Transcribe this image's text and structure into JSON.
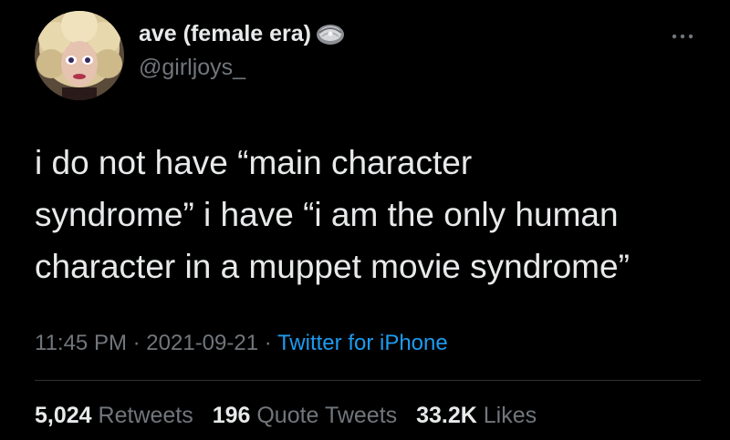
{
  "author": {
    "display_name": "ave (female era)",
    "handle": "@girljoys_",
    "name_emoji_icon": "oyster-icon",
    "avatar_icon": "avatar"
  },
  "tweet": {
    "lines": [
      "i do not have “main character",
      "syndrome” i have “i am the only human",
      "character in a muppet movie syndrome”"
    ]
  },
  "meta": {
    "time": "11:45 PM",
    "separator": "·",
    "date": "2021-09-21",
    "source": "Twitter for iPhone"
  },
  "stats": {
    "retweets_count": "5,024",
    "retweets_label": "Retweets",
    "quotes_count": "196",
    "quotes_label": "Quote Tweets",
    "likes_count": "33.2K",
    "likes_label": "Likes"
  },
  "colors": {
    "background": "#000000",
    "primary_text": "#e7e9ea",
    "secondary_text": "#71767b",
    "link": "#1d9bf0",
    "divider": "#2f3336"
  }
}
